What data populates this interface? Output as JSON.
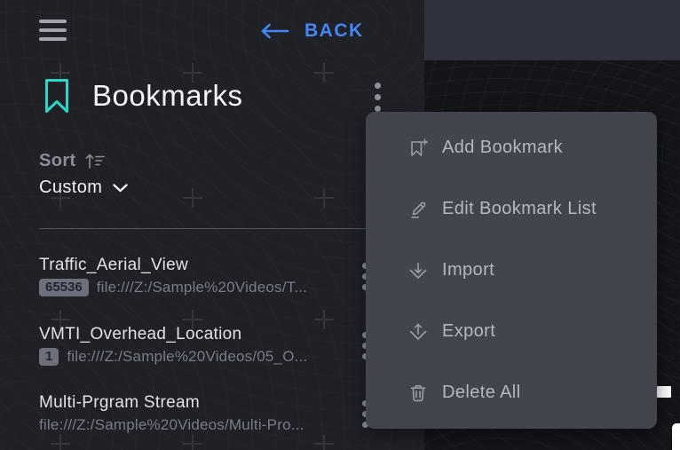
{
  "header": {
    "back_label": "BACK",
    "title": "Bookmarks"
  },
  "sort": {
    "label": "Sort",
    "value": "Custom"
  },
  "bookmarks": [
    {
      "title": "Traffic_Aerial_View",
      "badge": "65536",
      "path": "file:///Z:/Sample%20Videos/T..."
    },
    {
      "title": "VMTI_Overhead_Location",
      "badge": "1",
      "path": "file:///Z:/Sample%20Videos/05_O..."
    },
    {
      "title": "Multi-Prgram Stream",
      "badge": "",
      "path": "file:///Z:/Sample%20Videos/Multi-Pro..."
    }
  ],
  "menu": {
    "items": [
      {
        "icon": "add-bookmark-icon",
        "label": "Add Bookmark"
      },
      {
        "icon": "edit-icon",
        "label": "Edit Bookmark List"
      },
      {
        "icon": "import-icon",
        "label": "Import"
      },
      {
        "icon": "export-icon",
        "label": "Export"
      },
      {
        "icon": "delete-icon",
        "label": "Delete All"
      }
    ]
  },
  "colors": {
    "accent_blue": "#4585f1",
    "accent_teal": "#2fd6c8",
    "panel_bg": "#1f2127",
    "map_bg": "#141519",
    "menu_bg": "#43454e",
    "badge_bg": "#6d707b"
  }
}
